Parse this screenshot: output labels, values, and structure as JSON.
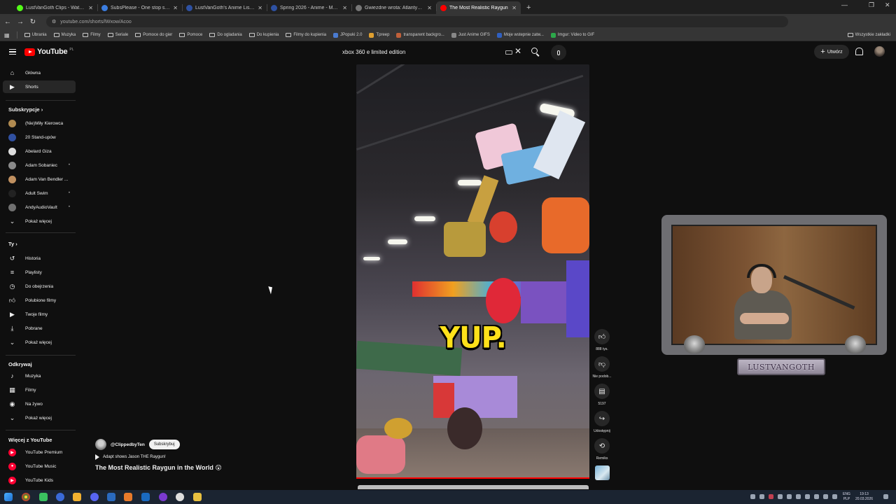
{
  "browser": {
    "tabs": [
      {
        "title": "LustVanGoth Clips - Watch Live",
        "color": "#53fc18",
        "active": false
      },
      {
        "title": "SubsPlease - One stop shop for",
        "color": "#3b7de0",
        "active": false
      },
      {
        "title": "LustVanGoth's Anime List - My",
        "color": "#2e51a2",
        "active": false
      },
      {
        "title": "Spring 2026 - Anime - MyAnim",
        "color": "#2e51a2",
        "active": false
      },
      {
        "title": "Gwiezdne wrota: Atlantyda / St",
        "color": "#777777",
        "active": false
      },
      {
        "title": "The Most Realistic Raygun",
        "color": "#ff0000",
        "active": true
      }
    ],
    "new_tab": "+",
    "url": "youtube.com/shorts/lWxow/Acoo",
    "bookmarks": [
      {
        "label": "Ubrania",
        "type": "folder"
      },
      {
        "label": "Muzyka",
        "type": "folder"
      },
      {
        "label": "Filmy",
        "type": "folder"
      },
      {
        "label": "Seriale",
        "type": "folder"
      },
      {
        "label": "Pomoce do gier",
        "type": "folder"
      },
      {
        "label": "Pomoce",
        "type": "folder"
      },
      {
        "label": "Do ogladania",
        "type": "folder"
      },
      {
        "label": "Do kupienia",
        "type": "folder"
      },
      {
        "label": "Filmy do kupienia",
        "type": "folder"
      },
      {
        "label": "JPopuki 2.0",
        "type": "site",
        "color": "#4a7bd0"
      },
      {
        "label": "Tpreep",
        "type": "site",
        "color": "#e0a030"
      },
      {
        "label": "transparent backgro...",
        "type": "site",
        "color": "#c0603a"
      },
      {
        "label": "Just Anime GIFS",
        "type": "site",
        "color": "#888888"
      },
      {
        "label": "Moje wstepnie zatw...",
        "type": "site",
        "color": "#3060c0"
      },
      {
        "label": "Imgur: Video to GIF",
        "type": "site",
        "color": "#2ca84a"
      }
    ],
    "all_bookmarks": "Wszystkie zakładki"
  },
  "youtube": {
    "logo_text": "YouTube",
    "country_code": "PL",
    "search_value": "xbox 360 e limited edition",
    "create_label": "Utwórz"
  },
  "sidebar": {
    "main": [
      {
        "label": "Główna",
        "icon": "home-icon",
        "active": false
      },
      {
        "label": "Shorts",
        "icon": "shorts-icon",
        "active": true
      }
    ],
    "subs_heading": "Subskrypcje",
    "subscriptions": [
      {
        "label": "(Nie)Miły Kierowca",
        "color": "#b08a50",
        "dot": false
      },
      {
        "label": "20 Stand-upów",
        "color": "#3050a0",
        "dot": false
      },
      {
        "label": "Abelard Giza",
        "color": "#dddddd",
        "dot": false
      },
      {
        "label": "Adam Sobaniec",
        "color": "#8a8a8a",
        "dot": true
      },
      {
        "label": "Adam Van Bendler ...",
        "color": "#c09060",
        "dot": false
      },
      {
        "label": "Adult Swim",
        "color": "#222222",
        "dot": true
      },
      {
        "label": "AndyAudioVault",
        "color": "#707070",
        "dot": true
      }
    ],
    "show_more": "Pokaż więcej",
    "you_heading": "Ty",
    "you_items": [
      {
        "label": "Historia",
        "icon": "history-icon"
      },
      {
        "label": "Playlisty",
        "icon": "playlists-icon"
      },
      {
        "label": "Do obejrzenia",
        "icon": "watch-later-icon"
      },
      {
        "label": "Polubione filmy",
        "icon": "liked-icon"
      },
      {
        "label": "Twoje filmy",
        "icon": "your-videos-icon"
      },
      {
        "label": "Pobrane",
        "icon": "download-icon"
      },
      {
        "label": "Pokaż więcej",
        "icon": "chevron-down-icon"
      }
    ],
    "explore_heading": "Odkrywaj",
    "explore_items": [
      {
        "label": "Muzyka",
        "icon": "music-icon"
      },
      {
        "label": "Filmy",
        "icon": "film-icon"
      },
      {
        "label": "Na żywo",
        "icon": "live-icon"
      },
      {
        "label": "Pokaż więcej",
        "icon": "chevron-down-icon"
      }
    ],
    "more_heading": "Więcej z YouTube",
    "more_items": [
      {
        "label": "YouTube Premium",
        "icon": "yt-premium-icon"
      },
      {
        "label": "YouTube Music",
        "icon": "yt-music-icon"
      },
      {
        "label": "YouTube Kids",
        "icon": "yt-kids-icon"
      }
    ]
  },
  "short": {
    "caption": "YUP.",
    "channel_handle": "@ClippedbyTen",
    "subscribe_label": "Subskrybuj",
    "playlist_label": "Adapt shows Jason THE Raygun!",
    "title": "The Most Realistic Raygun in the World 😲",
    "progress_percent": 100,
    "actions": {
      "likes": "888 tys.",
      "dislike_label": "Nie podob...",
      "comments": "5197",
      "share_label": "Udostępnij",
      "remix_label": "Remiks"
    }
  },
  "overlay": {
    "streamer_name": "LUSTVANGOTH"
  },
  "taskbar": {
    "language": "ENG",
    "layout": "PLP",
    "time": "19:13",
    "date": "20.03.2026"
  }
}
